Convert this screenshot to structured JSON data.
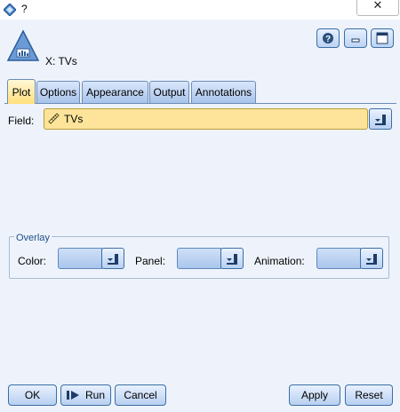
{
  "window": {
    "title": "?",
    "close_glyph": "✕",
    "app_icon": "diamond-app-icon"
  },
  "node": {
    "title": "X: TVs",
    "icon": "histogram-node-icon"
  },
  "toolbar": {
    "help_icon": "help-icon",
    "minimize_icon": "minimize-icon",
    "maximize_icon": "maximize-icon"
  },
  "tabs": [
    {
      "label": "Plot",
      "active": true
    },
    {
      "label": "Options",
      "active": false
    },
    {
      "label": "Appearance",
      "active": false
    },
    {
      "label": "Output",
      "active": false
    },
    {
      "label": "Annotations",
      "active": false
    }
  ],
  "field": {
    "label": "Field:",
    "value": "TVs",
    "icon": "ruler-icon"
  },
  "overlay": {
    "legend": "Overlay",
    "color_label": "Color:",
    "panel_label": "Panel:",
    "animation_label": "Animation:"
  },
  "buttons": {
    "ok": "OK",
    "run": "Run",
    "cancel": "Cancel",
    "apply": "Apply",
    "reset": "Reset"
  },
  "colors": {
    "field_bg": "#fde49a",
    "accent": "#3b6ea5",
    "dialog_bg": "#eef3fb"
  }
}
